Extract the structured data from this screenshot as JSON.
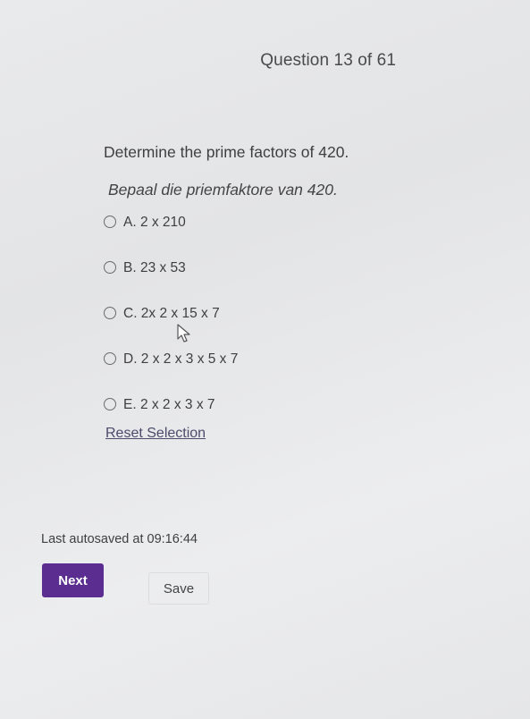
{
  "header": {
    "question_counter": "Question 13 of 61"
  },
  "question": {
    "text": "Determine the prime factors of 420.",
    "text_translation": "Bepaal die priemfaktore van 420.",
    "options": [
      {
        "label": "A. 2 x 210",
        "selected": false
      },
      {
        "label": "B. 23 x 53",
        "selected": false
      },
      {
        "label": "C. 2x 2 x 15 x 7",
        "selected": false
      },
      {
        "label": "D. 2 x 2 x 3 x 5 x 7",
        "selected": false
      },
      {
        "label": "E. 2 x 2 x 3 x 7",
        "selected": false
      }
    ],
    "reset_label": "Reset Selection"
  },
  "footer": {
    "autosave_text": "Last autosaved at 09:16:44",
    "next_label": "Next",
    "save_label": "Save"
  },
  "colors": {
    "accent": "#5c2d91"
  },
  "icons": {
    "cursor": "mouse-pointer-icon",
    "radio": "radio-unselected-icon"
  }
}
